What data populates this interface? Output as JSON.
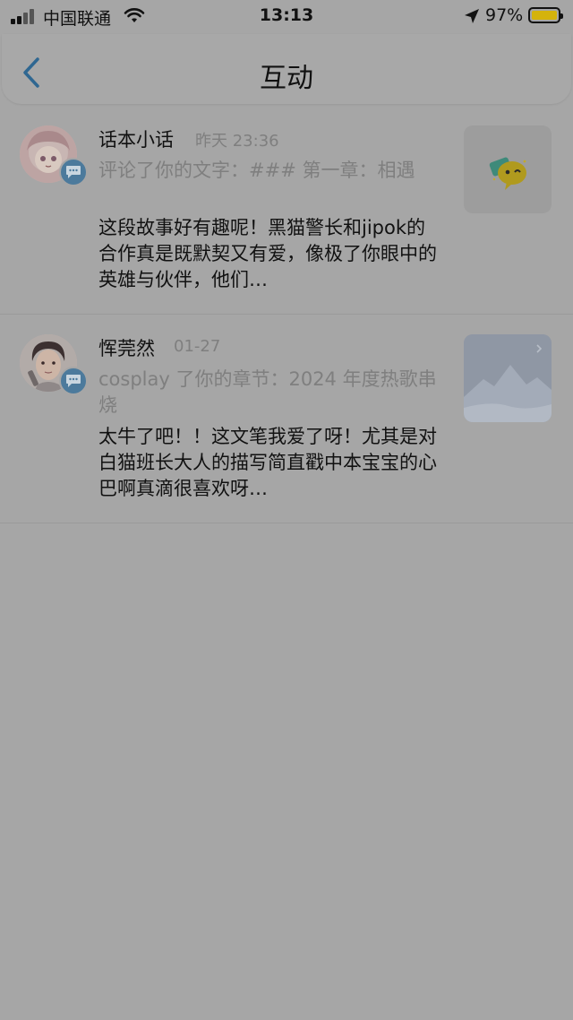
{
  "status_bar": {
    "carrier": "中国联通",
    "time": "13:13",
    "battery_percent": "97%",
    "battery_color": "#d4b30c"
  },
  "nav": {
    "title": "互动",
    "back_icon": "chevron-left-icon"
  },
  "items": [
    {
      "name": "话本小话",
      "time": "昨天 23:36",
      "action": "评论了你的文字：### 第一章：相遇",
      "content": "这段故事好有趣呢！黑猫警长和jipok的合作真是既默契又有爱，像极了你眼中的英雄与伙伴，他们…",
      "badge_icon": "comment-icon"
    },
    {
      "name": "恽莞然",
      "time": "01-27",
      "action": "cosplay 了你的章节：2024 年度热歌串烧",
      "content": "太牛了吧！！这文笔我爱了呀！尤其是对白猫班长大人的描写简直戳中本宝宝的心巴啊真滴很喜欢呀…",
      "badge_icon": "comment-icon"
    }
  ],
  "colors": {
    "overlay_background": "#a6a6a6",
    "badge": "#4c7a9c",
    "accent": "#3a6f96"
  }
}
